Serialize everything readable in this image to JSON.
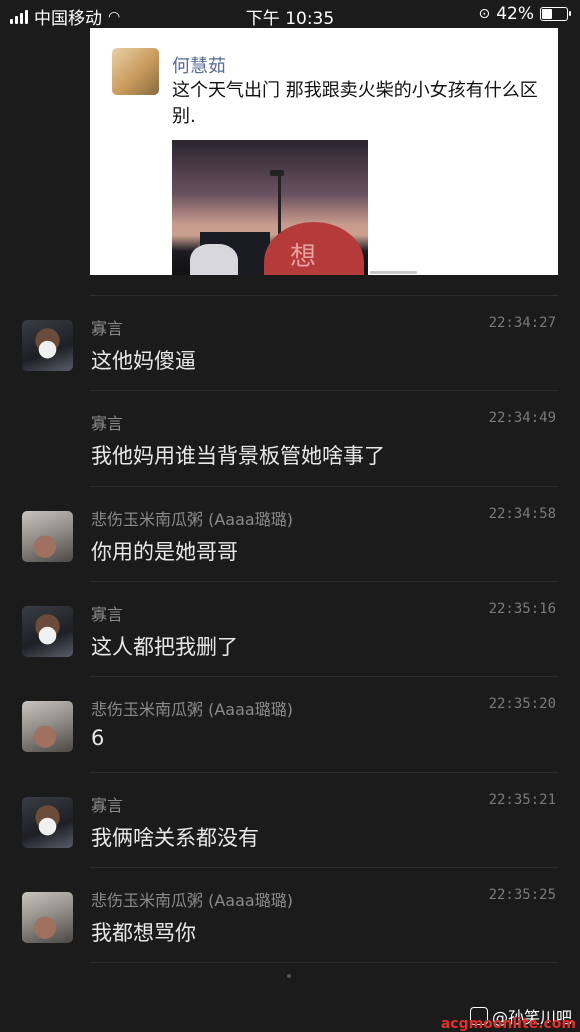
{
  "status_bar": {
    "carrier": "中国移动",
    "time": "下午 10:35",
    "battery": "42%",
    "battery_level": 0.42
  },
  "shared_post": {
    "author": "何慧茹",
    "text": "这个天气出门  那我跟卖火柴的小女孩有什么区别.",
    "photo_glyph": "想"
  },
  "messages": [
    {
      "sender": "寡言",
      "time": "22:34:27",
      "text": "这他妈傻逼",
      "avatar": "u1",
      "show_avatar": true
    },
    {
      "sender": "寡言",
      "time": "22:34:49",
      "text": "我他妈用谁当背景板管她啥事了",
      "avatar": "u1",
      "show_avatar": false
    },
    {
      "sender": "悲伤玉米南瓜粥 (Aaaa璐璐)",
      "time": "22:34:58",
      "text": "你用的是她哥哥",
      "avatar": "u2",
      "show_avatar": true
    },
    {
      "sender": "寡言",
      "time": "22:35:16",
      "text": "这人都把我删了",
      "avatar": "u1",
      "show_avatar": true
    },
    {
      "sender": "悲伤玉米南瓜粥 (Aaaa璐璐)",
      "time": "22:35:20",
      "text": "6",
      "avatar": "u2",
      "show_avatar": true
    },
    {
      "sender": "寡言",
      "time": "22:35:21",
      "text": "我俩啥关系都没有",
      "avatar": "u1",
      "show_avatar": true
    },
    {
      "sender": "悲伤玉米南瓜粥 (Aaaa璐璐)",
      "time": "22:35:25",
      "text": "我都想骂你",
      "avatar": "u2",
      "show_avatar": true
    }
  ],
  "watermark": {
    "label": "@孙笑川吧",
    "site": "acgmoonlite.com"
  }
}
